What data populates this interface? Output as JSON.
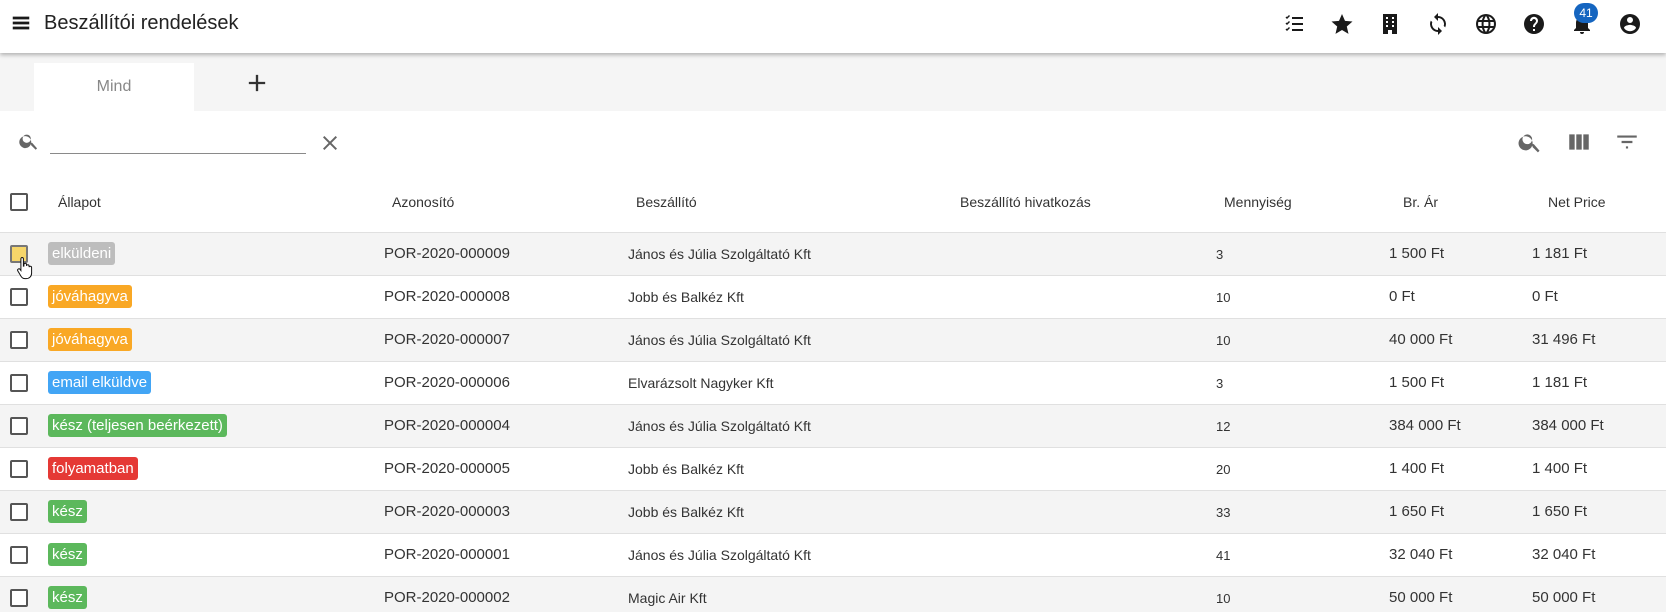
{
  "header": {
    "title": "Beszállítói rendelések",
    "icons": [
      "checklist-icon",
      "star-icon",
      "building-icon",
      "sync-icon",
      "globe-icon",
      "help-icon",
      "bell-icon",
      "account-icon"
    ],
    "notification_count": "41"
  },
  "tabs": [
    {
      "label": "Mind",
      "active": true
    }
  ],
  "search": {
    "value": "",
    "placeholder": ""
  },
  "table": {
    "columns": [
      "Állapot",
      "Azonosító",
      "Beszállító",
      "Beszállító hivatkozás",
      "Mennyiség",
      "Br. Ár",
      "Net Price"
    ],
    "rows": [
      {
        "status": "elküldeni",
        "status_color": "#bdbdbd",
        "id": "POR-2020-000009",
        "supplier": "János és Júlia Szolgáltató Kft",
        "ref": "",
        "qty": "3",
        "gross": "1 500 Ft",
        "net": "1 181 Ft"
      },
      {
        "status": "jóváhagyva",
        "status_color": "#f9a825",
        "id": "POR-2020-000008",
        "supplier": "Jobb és Balkéz Kft",
        "ref": "",
        "qty": "10",
        "gross": "0 Ft",
        "net": "0 Ft"
      },
      {
        "status": "jóváhagyva",
        "status_color": "#f9a825",
        "id": "POR-2020-000007",
        "supplier": "János és Júlia Szolgáltató Kft",
        "ref": "",
        "qty": "10",
        "gross": "40 000 Ft",
        "net": "31 496 Ft"
      },
      {
        "status": "email elküldve",
        "status_color": "#42a5f5",
        "id": "POR-2020-000006",
        "supplier": "Elvarázsolt Nagyker Kft",
        "ref": "",
        "qty": "3",
        "gross": "1 500 Ft",
        "net": "1 181 Ft"
      },
      {
        "status": "kész (teljesen beérkezett)",
        "status_color": "#5cb85c",
        "id": "POR-2020-000004",
        "supplier": "János és Júlia Szolgáltató Kft",
        "ref": "",
        "qty": "12",
        "gross": "384 000 Ft",
        "net": "384 000 Ft"
      },
      {
        "status": "folyamatban",
        "status_color": "#e53935",
        "id": "POR-2020-000005",
        "supplier": "Jobb és Balkéz Kft",
        "ref": "",
        "qty": "20",
        "gross": "1 400 Ft",
        "net": "1 400 Ft"
      },
      {
        "status": "kész",
        "status_color": "#5cb85c",
        "id": "POR-2020-000003",
        "supplier": "Jobb és Balkéz Kft",
        "ref": "",
        "qty": "33",
        "gross": "1 650 Ft",
        "net": "1 650 Ft"
      },
      {
        "status": "kész",
        "status_color": "#5cb85c",
        "id": "POR-2020-000001",
        "supplier": "János és Júlia Szolgáltató Kft",
        "ref": "",
        "qty": "41",
        "gross": "32 040 Ft",
        "net": "32 040 Ft"
      },
      {
        "status": "kész",
        "status_color": "#5cb85c",
        "id": "POR-2020-000002",
        "supplier": "Magic Air Kft",
        "ref": "",
        "qty": "10",
        "gross": "50 000 Ft",
        "net": "50 000 Ft"
      }
    ]
  }
}
